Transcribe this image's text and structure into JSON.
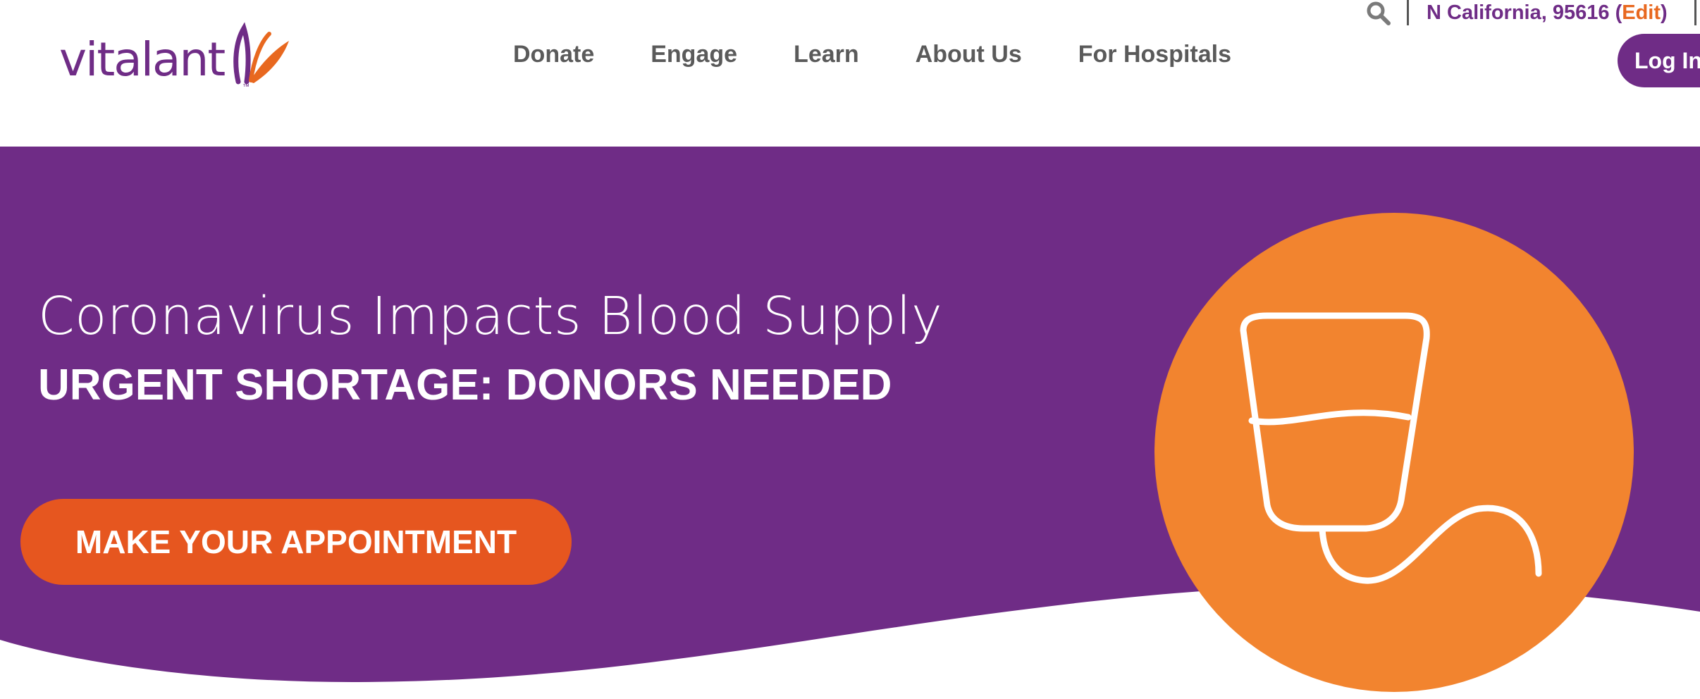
{
  "header": {
    "logo": {
      "text": "vitalant",
      "tm": "™"
    },
    "utility": {
      "search_icon": "search-icon",
      "location_text": "N California, 95616",
      "edit_label": "Edit"
    },
    "nav": [
      {
        "label": "Donate"
      },
      {
        "label": "Engage"
      },
      {
        "label": "Learn"
      },
      {
        "label": "About Us"
      },
      {
        "label": "For Hospitals"
      }
    ],
    "login_label": "Log In"
  },
  "hero": {
    "title": "Coronavirus Impacts Blood Supply",
    "subtitle": "URGENT SHORTAGE: DONORS NEEDED",
    "cta_label": "MAKE YOUR APPOINTMENT",
    "illustration": "blood-bag-icon"
  },
  "colors": {
    "brand_purple": "#6f2c86",
    "accent_orange": "#f2842f",
    "cta_orange": "#e6561f",
    "edit_orange": "#e8681f",
    "nav_gray": "#5a5a5a"
  }
}
